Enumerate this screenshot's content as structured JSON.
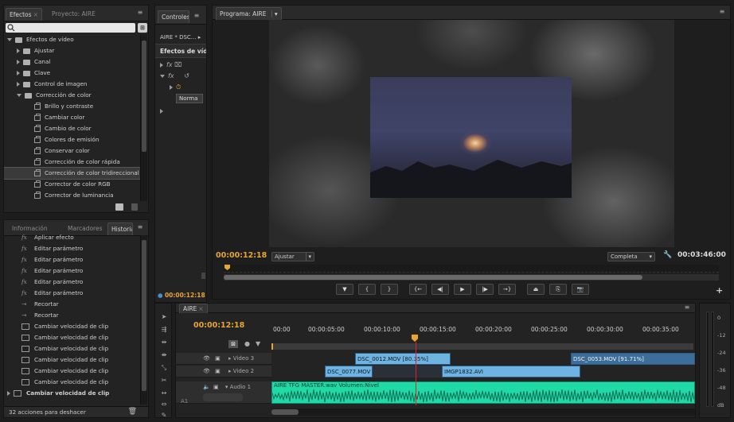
{
  "effects_panel": {
    "tabs": [
      "Efectos",
      "Proyecto: AIRE"
    ],
    "search_placeholder": "",
    "items": [
      {
        "label": "Efectos de vídeo",
        "type": "folder-open"
      },
      {
        "label": "Ajustar",
        "type": "folder"
      },
      {
        "label": "Canal",
        "type": "folder"
      },
      {
        "label": "Clave",
        "type": "folder"
      },
      {
        "label": "Control de imagen",
        "type": "folder"
      },
      {
        "label": "Corrección de color",
        "type": "folder-open"
      },
      {
        "label": "Brillo y contraste",
        "type": "effect"
      },
      {
        "label": "Cambiar color",
        "type": "effect"
      },
      {
        "label": "Cambio de color",
        "type": "effect"
      },
      {
        "label": "Colores de emisión",
        "type": "effect"
      },
      {
        "label": "Conservar color",
        "type": "effect"
      },
      {
        "label": "Corrección de color rápida",
        "type": "effect"
      },
      {
        "label": "Corrección de color tridireccional",
        "type": "effect",
        "selected": true
      },
      {
        "label": "Corrector de color RGB",
        "type": "effect"
      },
      {
        "label": "Corrector de luminancia",
        "type": "effect"
      }
    ]
  },
  "history_panel": {
    "tabs": [
      "Información",
      "Marcadores",
      "Historial"
    ],
    "items": [
      {
        "label": "Aplicar efecto",
        "icon": "fx"
      },
      {
        "label": "Editar parámetro",
        "icon": "fx"
      },
      {
        "label": "Editar parámetro",
        "icon": "fx"
      },
      {
        "label": "Editar parámetro",
        "icon": "fx"
      },
      {
        "label": "Editar parámetro",
        "icon": "fx"
      },
      {
        "label": "Editar parámetro",
        "icon": "fx"
      },
      {
        "label": "Recortar",
        "icon": "trim"
      },
      {
        "label": "Recortar",
        "icon": "trim"
      },
      {
        "label": "Cambiar velocidad de clip",
        "icon": "clip"
      },
      {
        "label": "Cambiar velocidad de clip",
        "icon": "clip"
      },
      {
        "label": "Cambiar velocidad de clip",
        "icon": "clip"
      },
      {
        "label": "Cambiar velocidad de clip",
        "icon": "clip"
      },
      {
        "label": "Cambiar velocidad de clip",
        "icon": "clip"
      },
      {
        "label": "Cambiar velocidad de clip",
        "icon": "clip"
      },
      {
        "label": "Cambiar velocidad de clip",
        "icon": "clip"
      }
    ],
    "footer": "32 acciones para deshacer"
  },
  "controls_panel": {
    "tab": "Controles",
    "source": "AIRE * DSC...",
    "section": "Efectos de vídeo",
    "param_value": "Norma",
    "timecode": "00:00:12:18"
  },
  "program_monitor": {
    "tab": "Programa: AIRE",
    "timecode_current": "00:00:12:18",
    "fit": "Ajustar",
    "quality": "Completa",
    "timecode_duration": "00:03:46:00",
    "progress": 0.055
  },
  "timeline": {
    "tab": "AIRE",
    "timecode": "00:00:12:18",
    "ruler": [
      "00:00",
      "00:00:05:00",
      "00:00:10:00",
      "00:00:15:00",
      "00:00:20:00",
      "00:00:25:00",
      "00:00:30:00",
      "00:00:35:00"
    ],
    "tracks": [
      {
        "name": "Video 3",
        "clips": [
          {
            "label": "DSC_0012.MOV [80.35%]"
          },
          {
            "label": "DSC_0053.MOV [91.71%]"
          }
        ]
      },
      {
        "name": "Video 2",
        "clips": [
          {
            "label": "DSC_0077.MOV"
          },
          {
            "label": "IMGP1832.AVI"
          }
        ]
      },
      {
        "name": "Audio 1",
        "clips": [
          {
            "label": "AIRE TFG MASTER.wav  Volumen:Nivel"
          }
        ]
      }
    ],
    "track_label_a1": "A1",
    "colors": {
      "video": "#6fb3e0",
      "audio": "#1fd9a6",
      "playhead": "#d6272a",
      "timecode": "#e8a531"
    }
  },
  "audio_meter": {
    "labels": [
      "0",
      "-12",
      "-24",
      "-36",
      "-48",
      "dB"
    ]
  }
}
